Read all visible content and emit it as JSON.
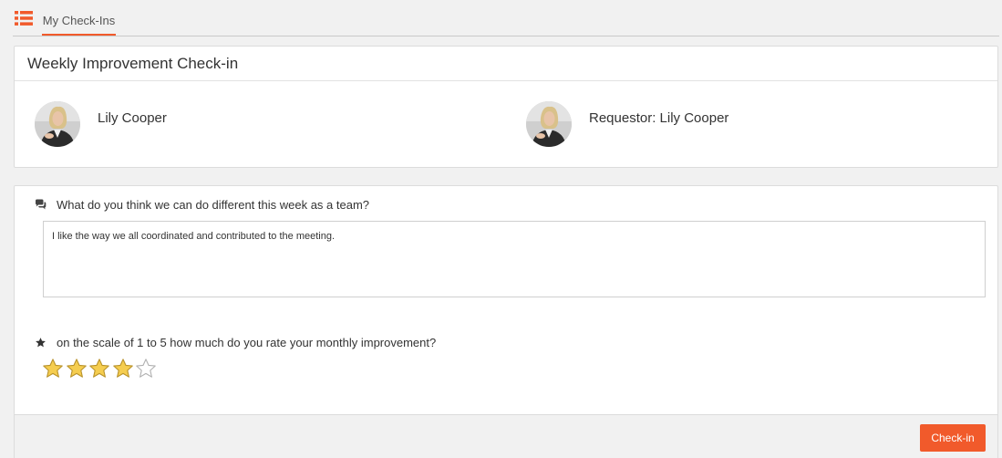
{
  "tabs": [
    {
      "label": "My Check-Ins",
      "active": true
    }
  ],
  "checkin": {
    "title": "Weekly Improvement Check-in",
    "assignee_name": "Lily Cooper",
    "requestor_label": "Requestor: Lily Cooper"
  },
  "questions": [
    {
      "icon": "comments-icon",
      "text": "What do you think we can do different this week as a team?",
      "answer": "I like the way we all coordinated and contributed to the meeting."
    },
    {
      "icon": "star-icon",
      "text": "on the scale of 1 to 5 how much do you rate your monthly improvement?",
      "rating": 4,
      "rating_max": 5
    }
  ],
  "footer": {
    "submit_label": "Check-in"
  },
  "colors": {
    "accent": "#f15a2b",
    "star_filled": "#f5cd4f",
    "star_outline": "#b0b0b0"
  }
}
